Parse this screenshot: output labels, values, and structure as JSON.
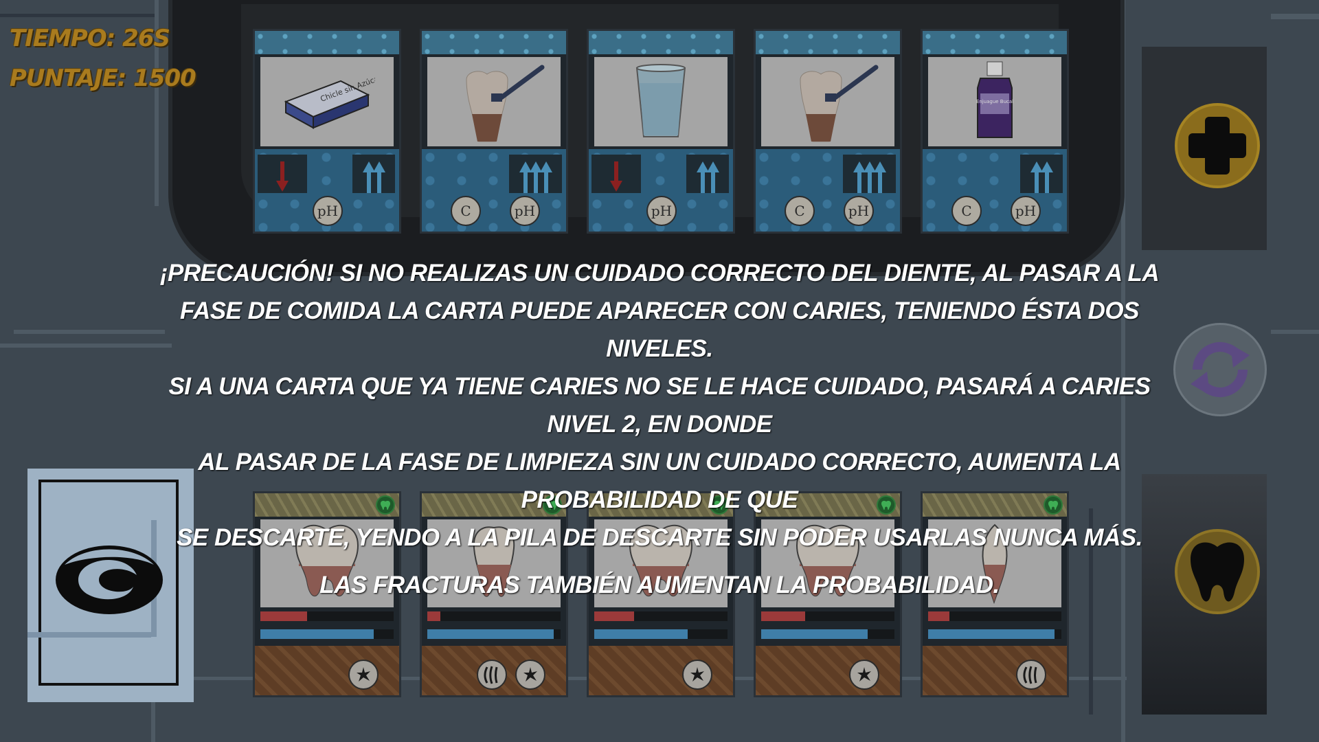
{
  "hud": {
    "time_label": "TIEMPO: 26S",
    "score_label": "PUNTAJE: 1500"
  },
  "message": {
    "line1": "¡Precaución! Si no realizas un cuidado correcto del diente, al pasar a la",
    "line2": "fase de comida la carta puede aparecer con caries, teniendo ésta dos niveles.",
    "line3": "Si a una carta que ya tiene caries no se le hace cuidado, pasará a caries nivel 2, en donde",
    "line4": "al pasar de la fase de limpieza sin un cuidado correcto, aumenta la probabilidad de que",
    "line5": "se descarte, yendo a la pila de descarte sin poder usarlas nunca más.",
    "line6": "Las fracturas también aumentan la probabilidad."
  },
  "care_cards": [
    {
      "item": "gum-pack",
      "item_label": "Chicle sin Azúcar",
      "down_arrows": 1,
      "up_arrows": 2,
      "badges": [
        "pH"
      ]
    },
    {
      "item": "toothbrush-on-tooth",
      "down_arrows": 0,
      "up_arrows": 3,
      "badges": [
        "C",
        "pH"
      ]
    },
    {
      "item": "water-glass",
      "down_arrows": 1,
      "up_arrows": 2,
      "badges": [
        "pH"
      ]
    },
    {
      "item": "toothbrush-on-tooth",
      "down_arrows": 0,
      "up_arrows": 3,
      "badges": [
        "C",
        "pH"
      ]
    },
    {
      "item": "mouthwash-bottle",
      "item_label": "Enjuague Bucal",
      "down_arrows": 0,
      "up_arrows": 2,
      "badges": [
        "C",
        "pH"
      ]
    }
  ],
  "tooth_cards": [
    {
      "tooth": "molar",
      "red_bar": 0.35,
      "blue_bar": 0.85,
      "icons": [
        "fracture-icon"
      ]
    },
    {
      "tooth": "premolar",
      "red_bar": 0.1,
      "blue_bar": 0.95,
      "icons": [
        "claw-icon",
        "fracture-icon"
      ]
    },
    {
      "tooth": "molar",
      "red_bar": 0.3,
      "blue_bar": 0.7,
      "icons": [
        "fracture-icon"
      ]
    },
    {
      "tooth": "molar",
      "red_bar": 0.33,
      "blue_bar": 0.8,
      "icons": [
        "fracture-icon"
      ]
    },
    {
      "tooth": "canine",
      "red_bar": 0.16,
      "blue_bar": 0.95,
      "icons": [
        "claw-icon"
      ]
    }
  ],
  "side_buttons": [
    {
      "name": "add-button",
      "icon": "plus-icon"
    },
    {
      "name": "refresh-button",
      "icon": "refresh-icon"
    },
    {
      "name": "tooth-button",
      "icon": "tooth-icon"
    }
  ],
  "colors": {
    "overlay": "#3d4750",
    "hud_gold": "#a97b1e",
    "health_red": "#9b3a3a",
    "health_blue": "#3f7ea8"
  }
}
